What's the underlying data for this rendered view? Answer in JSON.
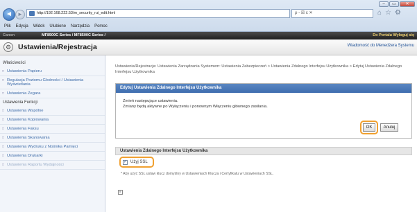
{
  "browser": {
    "url": "http://192.168.222.53/m_security_rui_edit.html",
    "address_right": "ρ - ☒ c ✕",
    "window_buttons": [
      "–",
      "▭",
      "✕"
    ],
    "menu": [
      "Plik",
      "Edycja",
      "Widok",
      "Ulubione",
      "Narzędzia",
      "Pomoc"
    ]
  },
  "app": {
    "brand": "Canon",
    "model": "MF8500C Series / MF8500C Series /",
    "portal_link": "Do Portalu  Wyloguj się",
    "title": "Ustawienia/Rejestracja",
    "admin_message": "Wiadomość do Menedżera Systemu"
  },
  "sidebar": {
    "header_preferences": "Właściwości",
    "preference_items": [
      "Ustawienia Papieru",
      "Regulacja Poziomu Głośności / Ustawienia Wyświetlania",
      "Ustawienia Zegara"
    ],
    "header_functions": "Ustawienia Funkcji",
    "function_items": [
      "Ustawienia Wspólne",
      "Ustawienia Kopiowania",
      "Ustawienia Faksu",
      "Ustawienia Skanowania",
      "Ustawienia Wydruku z Nośnika Pamięci",
      "Ustawienia Drukarki",
      "Ustawienia Raportu Wydajności"
    ]
  },
  "main": {
    "breadcrumb": "Ustawienia/Rejestracja: Ustawienia Zarządzania Systemem: Ustawienia Zabezpieczeń > Ustawienia Zdalnego Interfejsu Użytkownika > Edytuj Ustawienia Zdalnego Interfejsu Użytkownika",
    "dialog_title": "Edytuj Ustawienia Zdalnego Interfejsu Użytkownika",
    "dialog_line1": "Zmień następujące ustawienia.",
    "dialog_line2": "Zmiany będą aktywne po Wyłączeniu i ponownym Włączeniu głównego zasilania.",
    "ok_label": "OK",
    "cancel_label": "Anuluj",
    "section_title": "Ustawienia Zdalnego Interfejsu Użytkownika",
    "ssl_label": "Użyj SSL",
    "ssl_checked": true,
    "note": "* Aby użyć SSL ustaw klucz domyślny w Ustawieniach Klucza i Certyfikatu w Ustawieniach SSL."
  },
  "colors": {
    "highlight": "#f0a030",
    "dialog_title_bg": "#4a78b8",
    "link": "#3d6ba8"
  }
}
